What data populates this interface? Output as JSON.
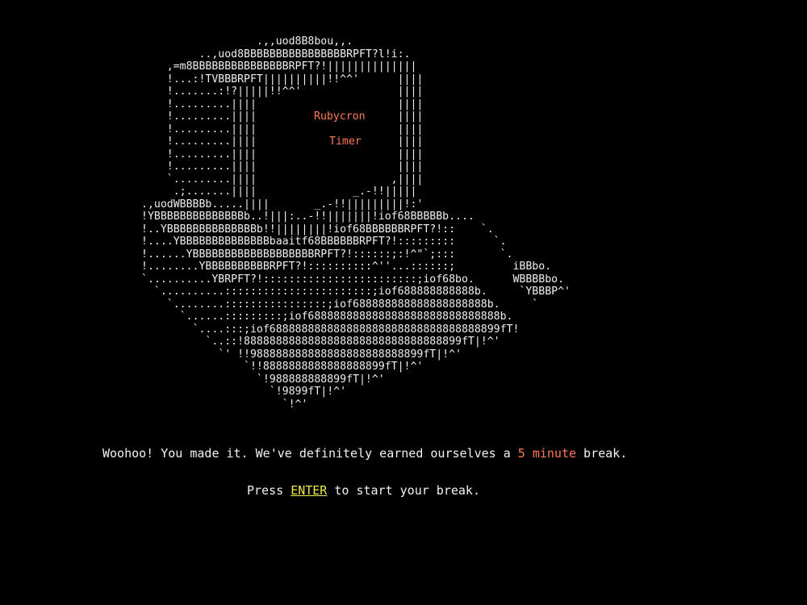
{
  "colors": {
    "background": "#000000",
    "text": "#f2f2f2",
    "art": "#efefef",
    "accent": "#ff7a59",
    "key_highlight": "#f0e84a"
  },
  "art": {
    "lines": [
      "                  .,,uod8B8bou,,.",
      "         ..,uod8BBBBBBBBBBBBBBBBRPFT?l!i:.",
      "    ,=m8BBBBBBBBBBBBBBBRPFT?!||||||||||||||",
      "    !...:!TVBBBRPFT||||||||||!!^^'      ||||",
      "    !.......:!?|||||!!^^'               ||||",
      "    !.........||||                      ||||",
      "    !.........||||                      ||||",
      "    !.........||||                      ||||",
      "    !.........||||                      ||||",
      "    !.........||||                      ||||",
      "    !.........||||                      ||||",
      "    `.........||||                     ,||||",
      "     .;.......||||               _.-!!|||||",
      ".,uodWBBBBb.....||||       _.-!!|||||||||!:'",
      "!YBBBBBBBBBBBBBBb..!|||:..-!!|||||||!iof68BBBBBb....",
      "!..YBBBBBBBBBBBBBBb!!||||||||!iof68BBBBBBRPFT?!::    `.",
      "!....YBBBBBBBBBBBBBBbaaitf68BBBBBBRPFT?!:::::::::      `.",
      "!......YBBBBBBBBBBBBBBBBBBBRPFT?!::::::;:!^\"`;:::       `.",
      "!........YBBBBBBBBBBRPFT?!::::::::::^''...::::::;         iBBbo.",
      "`..........YBRPFT?!::::::::::::::::::::::::;iof68bo.      WBBBBbo.",
      "  `..........:::::::::::::::::::::::;iof688888888888b.     `YBBBP^'",
      "    `........::::::::::::::::;iof688888888888888888888b.     `",
      "      `......:::::::::;iof688888888888888888888888888888b.",
      "        `....:::;iof688888888888888888888888888888888899fT!",
      "          `..::!8888888888888888888888888888888899fT|!^'",
      "            `' !!988888888888888888888888899fT|!^'",
      "                `!!8888888888888888899fT|!^'",
      "                  `!988888888899fT|!^'",
      "                    `!9899fT|!^'",
      "                      `!^'"
    ]
  },
  "screen": {
    "title": "Rubycron",
    "subtitle": "Timer"
  },
  "message": {
    "prefix": "Woohoo! You made it. We've definitely earned ourselves a ",
    "highlight": "5 minute",
    "suffix": " break."
  },
  "prompt": {
    "prefix": "Press ",
    "key": "ENTER",
    "suffix": " to start your break."
  }
}
